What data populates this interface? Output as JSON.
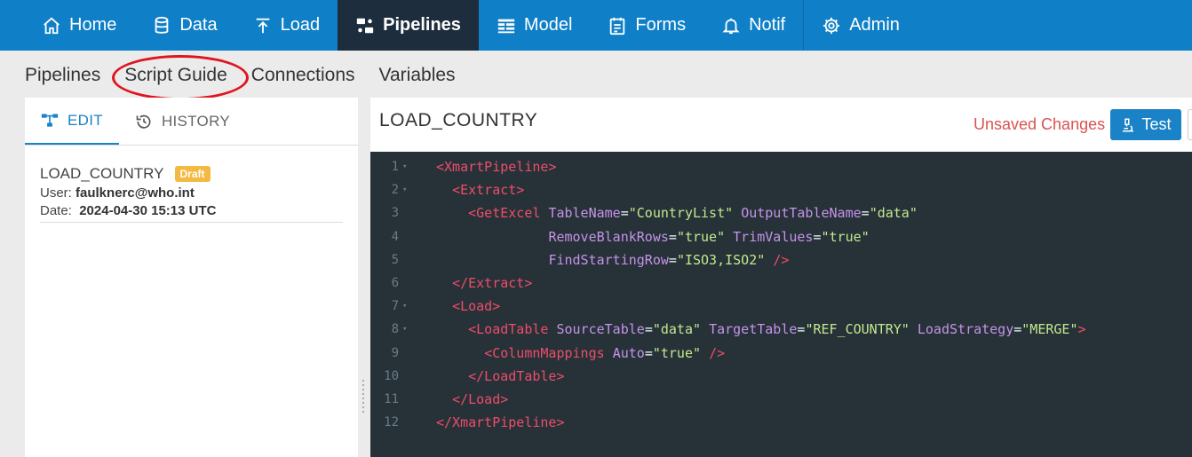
{
  "topnav": {
    "items": [
      {
        "label": "Home",
        "icon": "home-icon"
      },
      {
        "label": "Data",
        "icon": "database-icon"
      },
      {
        "label": "Load",
        "icon": "upload-icon"
      },
      {
        "label": "Pipelines",
        "icon": "pipelines-icon",
        "active": true
      },
      {
        "label": "Model",
        "icon": "table-icon"
      },
      {
        "label": "Forms",
        "icon": "forms-icon"
      },
      {
        "label": "Notif",
        "icon": "bell-icon"
      },
      {
        "label": "Admin",
        "icon": "gear-icon"
      }
    ],
    "colors": {
      "bar": "#0f7fc7",
      "active": "#1d2d3d"
    }
  },
  "subnav": {
    "items": [
      "Pipelines",
      "Script Guide",
      "Connections",
      "Variables"
    ],
    "highlighted": "Script Guide",
    "highlight_color": "#e0141e"
  },
  "leftpanel": {
    "tabs": {
      "edit": "EDIT",
      "history": "HISTORY"
    },
    "entry": {
      "name": "LOAD_COUNTRY",
      "badge": "Draft",
      "user_label": "User:",
      "user": "faulknerc@who.int",
      "date_label": "Date:",
      "date": "2024-04-30 15:13 UTC"
    }
  },
  "rightpanel": {
    "title": "LOAD_COUNTRY",
    "unsaved": "Unsaved Changes",
    "test_label": "Test"
  },
  "editor": {
    "line_numbers": [
      "1",
      "2",
      "3",
      "4",
      "5",
      "6",
      "7",
      "8",
      "9",
      "10",
      "11",
      "12"
    ],
    "lines": [
      "<XmartPipeline>",
      "  <Extract>",
      "    <GetExcel TableName=\"CountryList\" OutputTableName=\"data\"",
      "              RemoveBlankRows=\"true\" TrimValues=\"true\"",
      "              FindStartingRow=\"ISO3,ISO2\" />",
      "  </Extract>",
      "  <Load>",
      "    <LoadTable SourceTable=\"data\" TargetTable=\"REF_COUNTRY\" LoadStrategy=\"MERGE\">",
      "      <ColumnMappings Auto=\"true\" />",
      "    </LoadTable>",
      "  </Load>",
      "</XmartPipeline>"
    ]
  }
}
